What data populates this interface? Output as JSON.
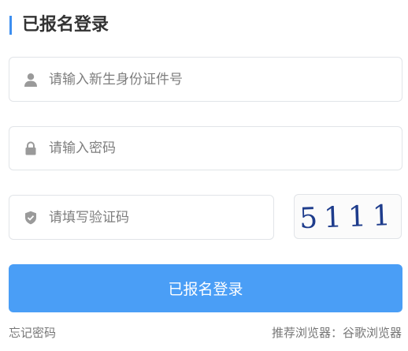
{
  "header": {
    "title": "已报名登录"
  },
  "form": {
    "id_number": {
      "placeholder": "请输入新生身份证件号",
      "value": ""
    },
    "password": {
      "placeholder": "请输入密码",
      "value": ""
    },
    "captcha_input": {
      "placeholder": "请填写验证码",
      "value": ""
    },
    "captcha_image": {
      "text": "5111"
    },
    "submit_label": "已报名登录"
  },
  "footer": {
    "forgot_password": "忘记密码",
    "browser_hint": "推荐浏览器：谷歌浏览器"
  },
  "icons": {
    "id_field": "user-icon",
    "password_field": "lock-icon",
    "captcha_field": "shield-check-icon"
  },
  "colors": {
    "accent": "#4a9ef6",
    "title_bar": "#3d8ff0",
    "captcha_text": "#1e3c8c"
  }
}
